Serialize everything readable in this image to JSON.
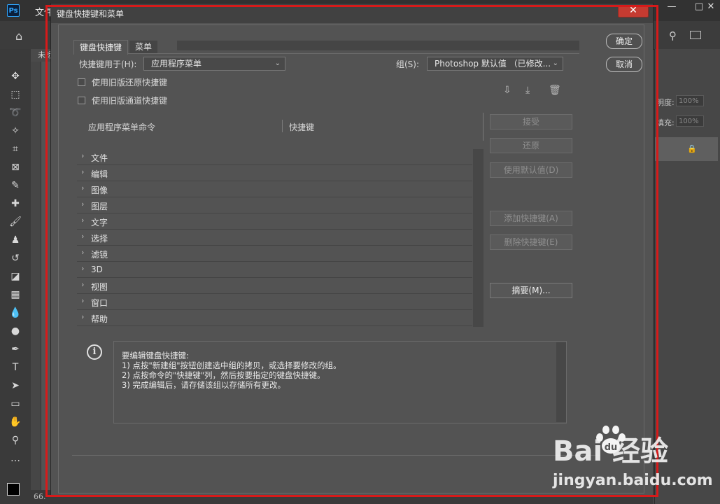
{
  "photoshop": {
    "logo": "Ps",
    "menu_file": "文件",
    "doc_tab": "未标",
    "status_zoom": "66.",
    "right_panel": {
      "opacity_label": "明度:",
      "opacity_value": "100%",
      "fill_label": "填充:",
      "fill_value": "100%"
    },
    "window_controls": {
      "minimize": "—",
      "restore": "□",
      "close": "✕"
    }
  },
  "dialog": {
    "title": "键盘快捷键和菜单",
    "close_label": "✕",
    "tabs": [
      {
        "label": "键盘快捷键",
        "active": true
      },
      {
        "label": "菜单",
        "active": false
      }
    ],
    "shortcuts_for_label": "快捷键用于(H):",
    "shortcuts_for_value": "应用程序菜单",
    "set_label": "组(S):",
    "set_value": "Photoshop 默认值 （已修改...",
    "checkboxes": [
      {
        "label": "使用旧版还原快捷键",
        "checked": false
      },
      {
        "label": "使用旧版通道快捷键",
        "checked": false
      }
    ],
    "table": {
      "columns": [
        "应用程序菜单命令",
        "快捷键"
      ],
      "rows": [
        "文件",
        "编辑",
        "图像",
        "图层",
        "文字",
        "选择",
        "滤镜",
        "3D",
        "视图",
        "窗口",
        "帮助"
      ]
    },
    "buttons": {
      "ok": "确定",
      "cancel": "取消",
      "accept": "接受",
      "undo": "还原",
      "use_default": "使用默认值(D)",
      "add_shortcut": "添加快捷键(A)",
      "delete_shortcut": "删除快捷键(E)",
      "summarize": "摘要(M)..."
    },
    "info": {
      "lines": [
        "要编辑键盘快捷键:",
        "1) 点按\"新建组\"按钮创建选中组的拷贝，或选择要修改的组。",
        "2) 点按命令的\"快捷键\"列，然后按要指定的键盘快捷键。",
        "3) 完成编辑后，请存储该组以存储所有更改。"
      ]
    }
  },
  "watermark": {
    "brand": "Bai  经验",
    "url": "jingyan.baidu.com"
  }
}
